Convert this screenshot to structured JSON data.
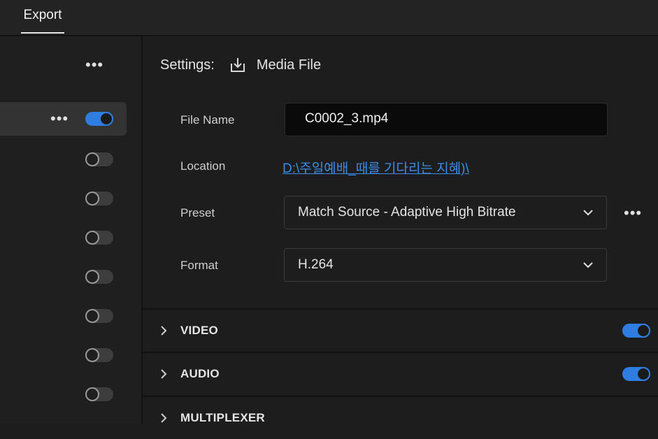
{
  "header": {
    "tab_label": "Export"
  },
  "left_panel": {
    "destinations": [
      {
        "enabled": true,
        "selected": true
      },
      {
        "enabled": false
      },
      {
        "enabled": false
      },
      {
        "enabled": false
      },
      {
        "enabled": false
      },
      {
        "enabled": false
      },
      {
        "enabled": false
      },
      {
        "enabled": false
      }
    ]
  },
  "settings": {
    "label": "Settings:",
    "target_icon": "download-icon",
    "target": "Media File",
    "file_name_label": "File Name",
    "file_name_value": "C0002_3.mp4",
    "location_label": "Location",
    "location_value": "D:\\주일예배_때를 기다리는 지혜)\\",
    "preset_label": "Preset",
    "preset_value": "Match Source - Adaptive High Bitrate",
    "format_label": "Format",
    "format_value": "H.264"
  },
  "sections": [
    {
      "label": "VIDEO",
      "enabled": true
    },
    {
      "label": "AUDIO",
      "enabled": true
    },
    {
      "label": "MULTIPLEXER"
    }
  ],
  "colors": {
    "accent": "#2f7de1",
    "link": "#3b8de8",
    "background": "#1d1d1d"
  }
}
